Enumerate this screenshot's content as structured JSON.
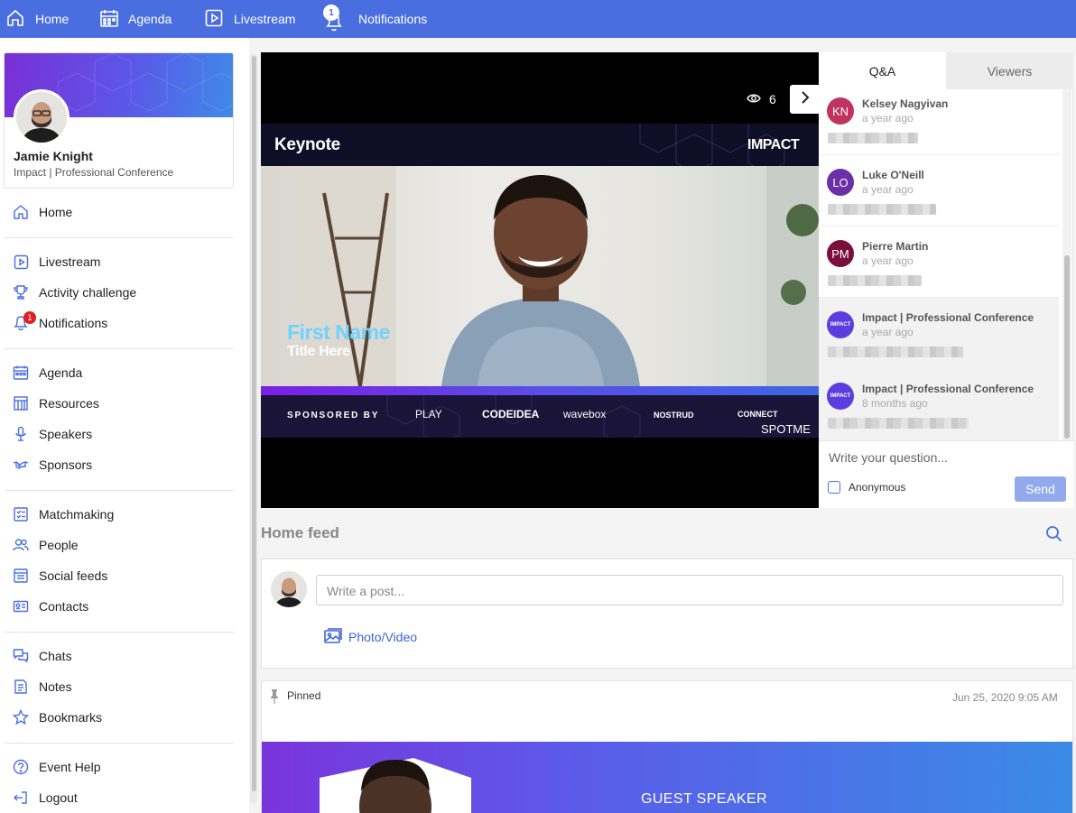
{
  "topbar": {
    "items": [
      {
        "label": "Home",
        "icon": "home-icon"
      },
      {
        "label": "Agenda",
        "icon": "calendar-icon"
      },
      {
        "label": "Livestream",
        "icon": "play-icon"
      },
      {
        "label": "Notifications",
        "icon": "bell-icon",
        "badge": "1"
      }
    ]
  },
  "profile": {
    "name": "Jamie Knight",
    "subtitle": "Impact | Professional Conference"
  },
  "sidebar": {
    "items": [
      {
        "label": "Home",
        "icon": "home-icon"
      },
      {
        "label": "Livestream",
        "icon": "play-icon"
      },
      {
        "label": "Activity challenge",
        "icon": "trophy-icon"
      },
      {
        "label": "Notifications",
        "icon": "bell-icon",
        "badge": "1"
      },
      {
        "label": "Agenda",
        "icon": "calendar-icon"
      },
      {
        "label": "Resources",
        "icon": "resources-icon"
      },
      {
        "label": "Speakers",
        "icon": "microphone-icon"
      },
      {
        "label": "Sponsors",
        "icon": "handshake-icon"
      },
      {
        "label": "Matchmaking",
        "icon": "checklist-icon"
      },
      {
        "label": "People",
        "icon": "people-icon"
      },
      {
        "label": "Social feeds",
        "icon": "feed-icon"
      },
      {
        "label": "Contacts",
        "icon": "contact-card-icon"
      },
      {
        "label": "Chats",
        "icon": "chat-icon"
      },
      {
        "label": "Notes",
        "icon": "notes-icon"
      },
      {
        "label": "Bookmarks",
        "icon": "star-icon"
      },
      {
        "label": "Event Help",
        "icon": "help-icon"
      },
      {
        "label": "Logout",
        "icon": "logout-icon"
      }
    ]
  },
  "stage": {
    "viewer_count": "6",
    "video": {
      "session_title": "Keynote",
      "brand": "IMPACT",
      "speaker_name": "First Name",
      "speaker_title": "Title Here",
      "sponsored_by": "SPONSORED BY",
      "sponsors": [
        "PLAY",
        "CODEIDEA",
        "wavebox",
        "NOSTRUD",
        "CONNECT",
        "SPOTME"
      ]
    }
  },
  "qa": {
    "tabs": [
      "Q&A",
      "Viewers"
    ],
    "active_tab": "Q&A",
    "questions": [
      {
        "initials": "KN",
        "name": "Kelsey Nagyivan",
        "time": "a year ago",
        "avatar_color": "#c0335e"
      },
      {
        "initials": "LO",
        "name": "Luke O'Neill",
        "time": "a year ago",
        "avatar_color": "#6b2fa8"
      },
      {
        "initials": "PM",
        "name": "Pierre Martin",
        "time": "a year ago",
        "avatar_color": "#7a0f3c"
      },
      {
        "initials": "IMPACT",
        "name": "Impact | Professional Conference",
        "time": "a year ago",
        "avatar_color": "#5a3ee0"
      },
      {
        "initials": "IMPACT",
        "name": "Impact | Professional Conference",
        "time": "8 months ago",
        "avatar_color": "#5a3ee0"
      }
    ],
    "input_placeholder": "Write your question...",
    "anonymous_label": "Anonymous",
    "send_label": "Send"
  },
  "feed": {
    "title": "Home feed",
    "post_placeholder": "Write a post...",
    "photo_video_label": "Photo/Video",
    "pinned": {
      "label": "Pinned",
      "date": "Jun 25, 2020 9:05 AM",
      "banner_text": "GUEST SPEAKER"
    }
  },
  "colors": {
    "accent": "#4a6ee0",
    "send_disabled": "#93a9ee",
    "badge_red": "#e02020"
  }
}
